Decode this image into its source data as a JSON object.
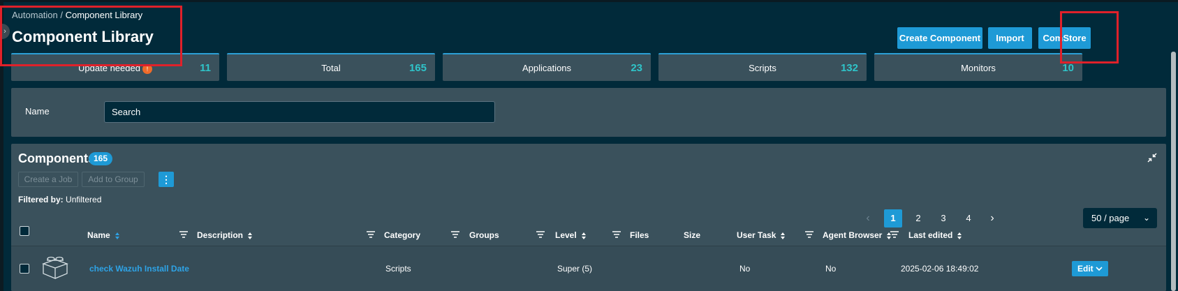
{
  "breadcrumb": {
    "parent": "Automation",
    "separator": " / ",
    "current": "Component Library"
  },
  "page": {
    "title": "Component Library"
  },
  "header_buttons": {
    "create": "Create Component",
    "import": "Import",
    "comstore": "ComStore"
  },
  "stats": [
    {
      "label": "Update needed",
      "value": "11",
      "badge": "!"
    },
    {
      "label": "Total",
      "value": "165"
    },
    {
      "label": "Applications",
      "value": "23"
    },
    {
      "label": "Scripts",
      "value": "132"
    },
    {
      "label": "Monitors",
      "value": "10"
    }
  ],
  "filter": {
    "name_label": "Name",
    "search_placeholder": "Search"
  },
  "components": {
    "title": "Components",
    "count": "165",
    "create_job": "Create a Job",
    "add_to_group": "Add to Group",
    "more": "⋮",
    "filtered_by_label": "Filtered by:",
    "filtered_by_value": "Unfiltered"
  },
  "pagination": {
    "prev": "‹",
    "next": "›",
    "pages": [
      "1",
      "2",
      "3",
      "4"
    ],
    "active_page": "1",
    "page_size": "50 / page",
    "chevron": "⌄"
  },
  "table": {
    "columns": {
      "name": "Name",
      "description": "Description",
      "category": "Category",
      "groups": "Groups",
      "level": "Level",
      "files": "Files",
      "size": "Size",
      "user_task": "User Task",
      "agent_browser": "Agent Browser",
      "last_edited": "Last edited"
    },
    "rows": [
      {
        "name": "check Wazuh Install Date",
        "category": "Scripts",
        "level": "Super (5)",
        "user_task": "No",
        "agent_browser": "No",
        "last_edited": "2025-02-06 18:49:02",
        "action": "Edit"
      }
    ]
  },
  "colors": {
    "background": "#012a3a",
    "panel": "#3a515c",
    "accent": "#1e9ad6",
    "stat_value": "#2fc4c9",
    "highlight_box": "#e0212a",
    "badge": "#ef6b2a"
  }
}
